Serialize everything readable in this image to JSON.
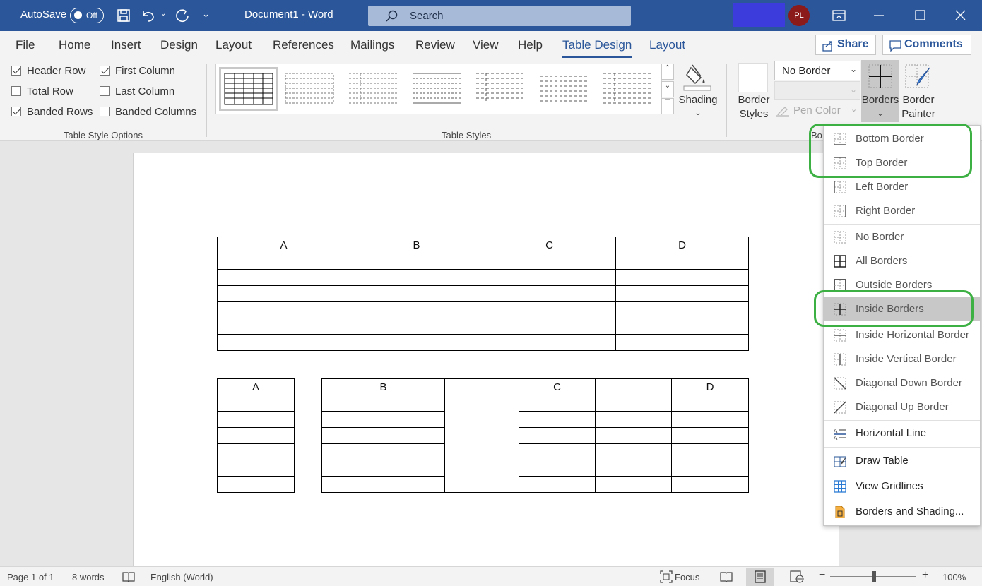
{
  "titlebar": {
    "autosave": "AutoSave",
    "toggle": "Off",
    "doc_title": "Document1  -  Word",
    "search_placeholder": "Search",
    "avatar": "PL"
  },
  "tabs": [
    "File",
    "Home",
    "Insert",
    "Design",
    "Layout",
    "References",
    "Mailings",
    "Review",
    "View",
    "Help",
    "Table Design",
    "Layout"
  ],
  "share": "Share",
  "comments": "Comments",
  "style_options": {
    "header_row": "Header Row",
    "first_column": "First Column",
    "total_row": "Total Row",
    "last_column": "Last Column",
    "banded_rows": "Banded Rows",
    "banded_columns": "Banded Columns",
    "group": "Table Style Options"
  },
  "styles_group": "Table Styles",
  "shading": "Shading",
  "borders_group": {
    "border_styles": [
      "Border",
      "Styles"
    ],
    "line_style": "No Border",
    "pen_color": "Pen Color",
    "borders": "Borders",
    "border_painter": [
      "Border",
      "Painter"
    ],
    "group_short": "Bo"
  },
  "table1": {
    "headers": [
      "A",
      "B",
      "C",
      "D"
    ]
  },
  "table2": {
    "headers": [
      "A",
      "B",
      "C",
      "",
      "D"
    ]
  },
  "menu": [
    {
      "label": "Bottom Border",
      "icon": "bottom-border-icon"
    },
    {
      "label": "Top Border",
      "icon": "top-border-icon"
    },
    {
      "label": "Left Border",
      "icon": "left-border-icon"
    },
    {
      "label": "Right Border",
      "icon": "right-border-icon"
    },
    {
      "label": "No Border",
      "icon": "no-border-icon"
    },
    {
      "label": "All Borders",
      "icon": "all-borders-icon"
    },
    {
      "label": "Outside Borders",
      "icon": "outside-borders-icon"
    },
    {
      "label": "Inside Borders",
      "icon": "inside-borders-icon"
    },
    {
      "label": "Inside Horizontal Border",
      "icon": "inside-horizontal-border-icon"
    },
    {
      "label": "Inside Vertical Border",
      "icon": "inside-vertical-border-icon"
    },
    {
      "label": "Diagonal Down Border",
      "icon": "diagonal-down-border-icon"
    },
    {
      "label": "Diagonal Up Border",
      "icon": "diagonal-up-border-icon"
    },
    {
      "label": "Horizontal Line",
      "icon": "horizontal-line-icon"
    },
    {
      "label": "Draw Table",
      "icon": "draw-table-icon"
    },
    {
      "label": "View Gridlines",
      "icon": "view-gridlines-icon"
    },
    {
      "label": "Borders and Shading...",
      "icon": "borders-shading-icon"
    }
  ],
  "status": {
    "page": "Page 1 of 1",
    "words": "8 words",
    "language": "English (World)",
    "focus": "Focus",
    "zoom": "100%"
  },
  "colors": {
    "accent": "#2b579a",
    "highlight_ring": "#3cb043"
  }
}
